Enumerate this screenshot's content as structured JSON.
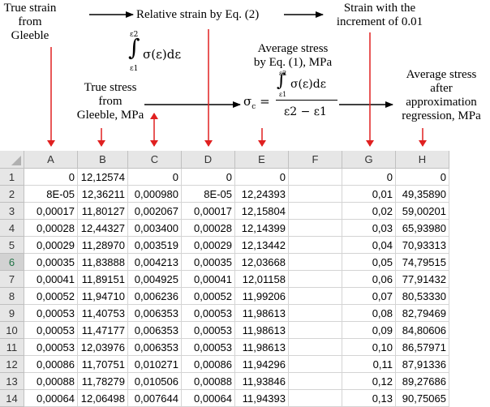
{
  "annotations": {
    "true_strain": [
      "True strain",
      "from",
      "Gleeble"
    ],
    "relative_strain": "Relative strain by Eq. (2)",
    "strain_increment": [
      "Strain with the",
      "increment of 0.01"
    ],
    "avg_stress_eq1": [
      "Average stress",
      "by Eq. (1), MPa"
    ],
    "true_stress": [
      "True stress",
      "from",
      "Gleeble, MPa"
    ],
    "avg_stress_approx": [
      "Average stress",
      "after",
      "approximation",
      "regression, MPa"
    ],
    "integral_upper": "ε2",
    "integral_lower": "ε1",
    "integrand": "σ(ε)dε",
    "sigma_c": "σc =",
    "denominator": "ε2 − ε1"
  },
  "colors": {
    "arrow_red": "#e02020",
    "arrow_black": "#000000",
    "header_bg": "#e6e6e6",
    "grid": "#d4d4d4"
  },
  "sheet": {
    "columns": [
      "A",
      "B",
      "C",
      "D",
      "E",
      "F",
      "G",
      "H"
    ],
    "rows": [
      {
        "n": "1",
        "cells": [
          "0",
          "12,12574",
          "0",
          "0",
          "0",
          "",
          "0",
          "0"
        ]
      },
      {
        "n": "2",
        "cells": [
          "8E-05",
          "12,36211",
          "0,000980",
          "8E-05",
          "12,24393",
          "",
          "0,01",
          "49,35890"
        ]
      },
      {
        "n": "3",
        "cells": [
          "0,00017",
          "11,80127",
          "0,002067",
          "0,00017",
          "12,15804",
          "",
          "0,02",
          "59,00201"
        ]
      },
      {
        "n": "4",
        "cells": [
          "0,00028",
          "12,44327",
          "0,003400",
          "0,00028",
          "12,14399",
          "",
          "0,03",
          "65,93980"
        ]
      },
      {
        "n": "5",
        "cells": [
          "0,00029",
          "11,28970",
          "0,003519",
          "0,00029",
          "12,13442",
          "",
          "0,04",
          "70,93313"
        ]
      },
      {
        "n": "6",
        "cells": [
          "0,00035",
          "11,83888",
          "0,004213",
          "0,00035",
          "12,03668",
          "",
          "0,05",
          "74,79515"
        ]
      },
      {
        "n": "7",
        "cells": [
          "0,00041",
          "11,89151",
          "0,004925",
          "0,00041",
          "12,01158",
          "",
          "0,06",
          "77,91432"
        ]
      },
      {
        "n": "8",
        "cells": [
          "0,00052",
          "11,94710",
          "0,006236",
          "0,00052",
          "11,99206",
          "",
          "0,07",
          "80,53330"
        ]
      },
      {
        "n": "9",
        "cells": [
          "0,00053",
          "11,40753",
          "0,006353",
          "0,00053",
          "11,98613",
          "",
          "0,08",
          "82,79469"
        ]
      },
      {
        "n": "10",
        "cells": [
          "0,00053",
          "11,47177",
          "0,006353",
          "0,00053",
          "11,98613",
          "",
          "0,09",
          "84,80606"
        ]
      },
      {
        "n": "11",
        "cells": [
          "0,00053",
          "12,03976",
          "0,006353",
          "0,00053",
          "11,98613",
          "",
          "0,10",
          "86,57971"
        ]
      },
      {
        "n": "12",
        "cells": [
          "0,00086",
          "11,70751",
          "0,010271",
          "0,00086",
          "11,94296",
          "",
          "0,11",
          "87,91336"
        ]
      },
      {
        "n": "13",
        "cells": [
          "0,00088",
          "11,78279",
          "0,010506",
          "0,00088",
          "11,93846",
          "",
          "0,12",
          "89,27686"
        ]
      },
      {
        "n": "14",
        "cells": [
          "0,00064",
          "12,06498",
          "0,007644",
          "0,00064",
          "11,94393",
          "",
          "0,13",
          "90,75065"
        ]
      }
    ]
  }
}
